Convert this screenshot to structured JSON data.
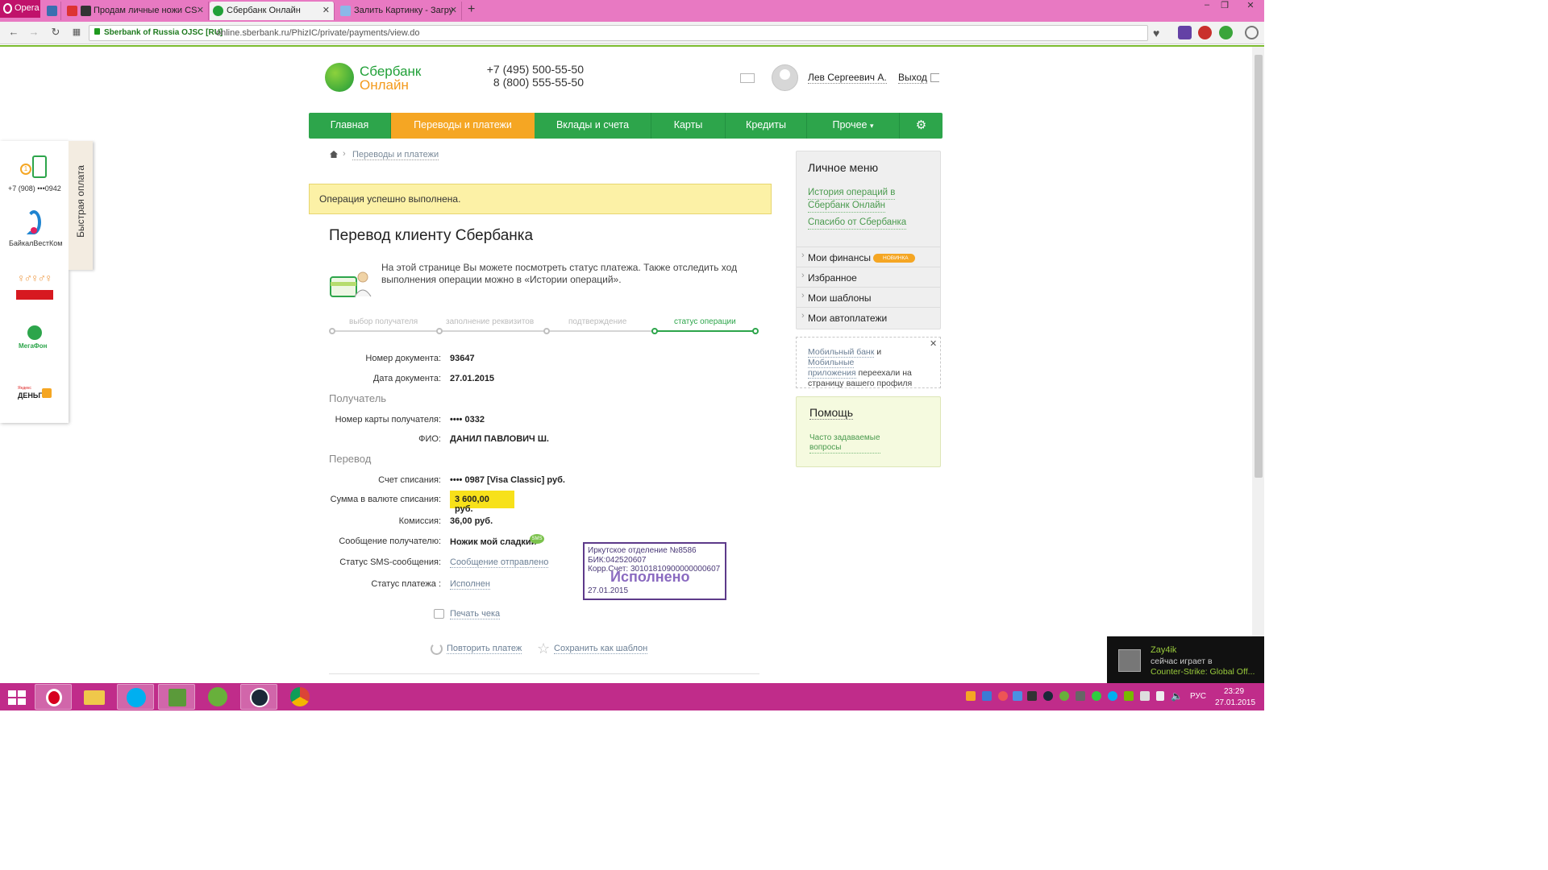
{
  "browser": {
    "menu_label": "Opera",
    "tabs": [
      {
        "title": "Продам личные ножи CS"
      },
      {
        "title": "Сбербанк Онлайн"
      },
      {
        "title": "Залить Картинку - Загру"
      }
    ],
    "security_label": "Sberbank of Russia OJSC [RU]",
    "url": "online.sberbank.ru/PhizIC/private/payments/view.do"
  },
  "header": {
    "logo_line1": "Сбербанк",
    "logo_line2": "Онлайн",
    "phone1_prefix": "+7 (495) ",
    "phone1_number": "500-55-50",
    "phone2_prefix": "8 (800) ",
    "phone2_number": "555-55-50",
    "user_name": "Лев Сергеевич А.",
    "logout_label": "Выход"
  },
  "nav": {
    "items": [
      {
        "label": "Главная"
      },
      {
        "label": "Переводы и платежи"
      },
      {
        "label": "Вклады и счета"
      },
      {
        "label": "Карты"
      },
      {
        "label": "Кредиты"
      },
      {
        "label": "Прочее"
      }
    ],
    "settings_icon": "gear-icon"
  },
  "breadcrumb": {
    "link": "Переводы и платежи"
  },
  "success_message": "Операция успешно выполнена.",
  "page_title": "Перевод клиенту Сбербанка",
  "info_text": "На этой странице Вы можете посмотреть статус платежа. Также отследить ход выполнения операции можно в «Истории операций».",
  "steps": [
    {
      "label": "выбор получателя"
    },
    {
      "label": "заполнение реквизитов"
    },
    {
      "label": "подтверждение"
    },
    {
      "label": "статус операции"
    }
  ],
  "fields": {
    "doc_number_label": "Номер документа:",
    "doc_number": "93647",
    "doc_date_label": "Дата документа:",
    "doc_date": "27.01.2015",
    "recipient_section": "Получатель",
    "card_label": "Номер карты получателя:",
    "card_value": "•••• 0332",
    "fio_label": "ФИО:",
    "fio_value": "ДАНИЛ ПАВЛОВИЧ Ш.",
    "transfer_section": "Перевод",
    "account_label": "Счет списания:",
    "account_value": "•••• 0987  [Visa Classic]  руб.",
    "amount_label": "Сумма в валюте списания:",
    "amount_value": "3 600,00  руб.",
    "commission_label": "Комиссия:",
    "commission_value": "36,00 руб.",
    "message_label": "Сообщение получателю:",
    "message_value": "Ножик мой сладкий",
    "sms_badge": "SMS",
    "sms_status_label": "Статус SMS-сообщения:",
    "sms_status_value": "Сообщение отправлено",
    "payment_status_label": "Статус платежа :",
    "payment_status_value": "Исполнен"
  },
  "stamp": {
    "line1": "Иркутское отделение №8586",
    "line2": "БИК:042520607",
    "line3": "Корр.Счет: 30101810900000000607",
    "status": "Исполнено",
    "date": "27.01.2015"
  },
  "actions": {
    "print": "Печать чека",
    "repeat": "Повторить платеж",
    "save_template": "Сохранить как шаблон"
  },
  "personal_menu": {
    "title": "Личное меню",
    "link1_line1": "История операций в",
    "link1_line2": "Сбербанк Онлайн",
    "link2": "Спасибо от Сбербанка",
    "items": [
      {
        "label": "Мои финансы"
      },
      {
        "label": "Избранное"
      },
      {
        "label": "Мои шаблоны"
      },
      {
        "label": "Мои автоплатежи"
      }
    ],
    "new_badge": "НОВИНКА"
  },
  "notice": {
    "link1": "Мобильный банк",
    "and": " и ",
    "link2a": "Мобильные",
    "link2b": "приложения",
    "rest1": " переехали на",
    "rest2": "страницу вашего профиля"
  },
  "help": {
    "title": "Помощь",
    "link_line1": "Часто задаваемые",
    "link_line2": "вопросы"
  },
  "quick_pay": {
    "tab_label": "Быстрая оплата",
    "phone": "+7 (908) •••0942",
    "provider1": "БайкалВестКом",
    "provider3": "МегаФон",
    "yandex_small": "Яндекс",
    "yandex_big": "ДЕНЬГИ"
  },
  "notification": {
    "name": "Zay4ik",
    "status": "сейчас играет в",
    "game": "Counter-Strike: Global Off..."
  },
  "taskbar": {
    "language": "РУС",
    "time": "23:29",
    "date": "27.01.2015"
  },
  "colors": {
    "sber_green": "#2da54b",
    "active_orange": "#f5a623",
    "success_bg": "#fcf1a6",
    "amount_highlight": "#f7e11a",
    "tab_bar_pink": "#e879c2",
    "taskbar_magenta": "#c02c8a"
  }
}
